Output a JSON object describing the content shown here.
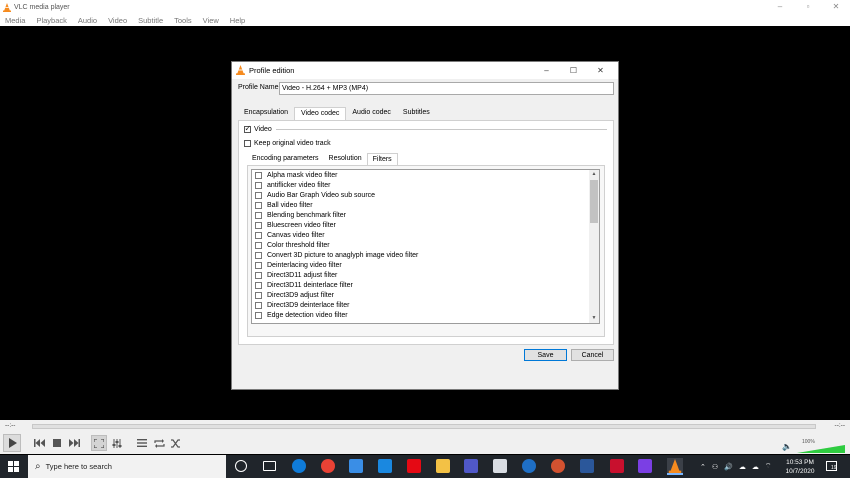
{
  "app": {
    "title": "VLC media player",
    "menu": [
      "Media",
      "Playback",
      "Audio",
      "Video",
      "Subtitle",
      "Tools",
      "View",
      "Help"
    ]
  },
  "dialog": {
    "title": "Profile edition",
    "profile_label": "Profile Name",
    "profile_value": "Video - H.264 + MP3 (MP4)",
    "tabs": [
      "Encapsulation",
      "Video codec",
      "Audio codec",
      "Subtitles"
    ],
    "active_tab": "Video codec",
    "video_label": "Video",
    "video_checked": true,
    "keep_original_label": "Keep original video track",
    "keep_original_checked": false,
    "subtabs": [
      "Encoding parameters",
      "Resolution",
      "Filters"
    ],
    "active_subtab": "Filters",
    "filters": [
      "Alpha mask video filter",
      "antiflicker video filter",
      "Audio Bar Graph Video sub source",
      "Ball video filter",
      "Blending benchmark filter",
      "Bluescreen video filter",
      "Canvas video filter",
      "Color threshold filter",
      "Convert 3D picture to anaglyph image video filter",
      "Deinterlacing video filter",
      "Direct3D11 adjust filter",
      "Direct3D11 deinterlace filter",
      "Direct3D9 adjust filter",
      "Direct3D9 deinterlace filter",
      "Edge detection video filter"
    ],
    "save_label": "Save",
    "cancel_label": "Cancel"
  },
  "player": {
    "time_elapsed": "--:--",
    "time_remaining": "--:--",
    "volume_percent": "100%"
  },
  "taskbar": {
    "search_placeholder": "Type here to search",
    "clock_time": "10:53 PM",
    "clock_date": "10/7/2020",
    "notification_count": "19"
  },
  "colors": {
    "vlc_orange": "#f68b1f",
    "accent_blue": "#0078d7",
    "volume_green": "#2ecc40",
    "taskbar_bg": "#20252b"
  }
}
